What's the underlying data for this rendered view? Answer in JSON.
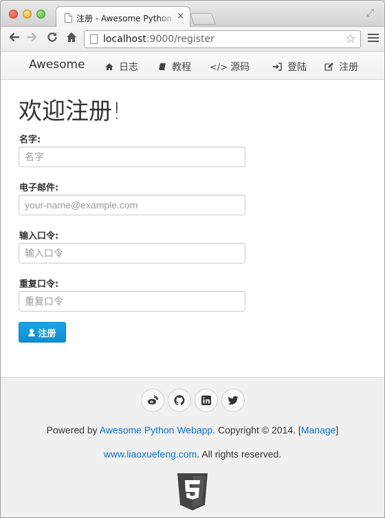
{
  "browser": {
    "tab_title": "注册 - Awesome Python Webapp",
    "tab_close": "×",
    "url_host": "localhost",
    "url_rest": ":9000/register"
  },
  "navbar": {
    "brand": "Awesome",
    "items": [
      {
        "label": "日志",
        "icon": "home-icon"
      },
      {
        "label": "教程",
        "icon": "book-icon"
      },
      {
        "label": "源码",
        "icon": "code-icon"
      },
      {
        "label": "登陆",
        "icon": "sign-in-icon"
      },
      {
        "label": "注册",
        "icon": "edit-icon"
      }
    ]
  },
  "page": {
    "title": "欢迎注册!"
  },
  "form": {
    "fields": [
      {
        "label": "名字:",
        "placeholder": "名字"
      },
      {
        "label": "电子邮件:",
        "placeholder": "your-name@example.com"
      },
      {
        "label": "输入口令:",
        "placeholder": "输入口令"
      },
      {
        "label": "重复口令:",
        "placeholder": "重复口令"
      }
    ],
    "submit_label": "注册"
  },
  "footer": {
    "social": [
      "weibo-icon",
      "github-icon",
      "linkedin-icon",
      "twitter-icon"
    ],
    "powered_prefix": "Powered by ",
    "powered_link": "Awesome Python Webapp",
    "copyright": ". Copyright © 2014. [",
    "manage_link": "Manage",
    "bracket_close": "]",
    "site_link": "www.liaoxuefeng.com",
    "rights": ". All rights reserved."
  },
  "colors": {
    "primary": "#0a8fd2",
    "link": "#0a73c4",
    "footer_bg": "#f0f0f0"
  }
}
